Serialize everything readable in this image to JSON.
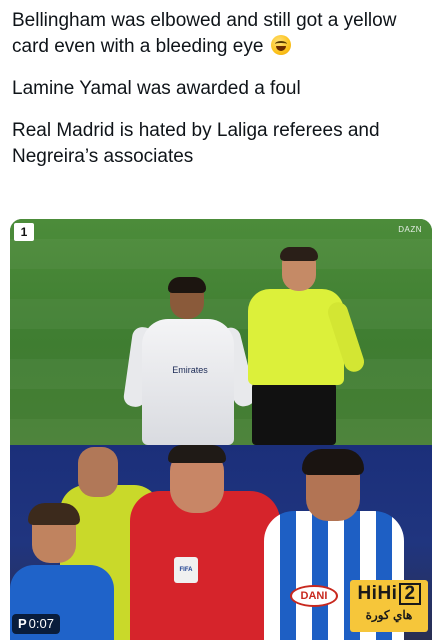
{
  "tweet": {
    "lines": [
      "Bellingham was elbowed and still got a yellow card even with a bleeding eye",
      "Lamine Yamal was awarded a foul",
      "Real Madrid is hated by Laliga referees and Negreira’s associates"
    ],
    "emoji_icon": "rofl-emoji-icon"
  },
  "media": {
    "video_timer": "0:07",
    "timer_prefix": "P",
    "top_scene": {
      "badge_text": "1",
      "corner_logo": "DAZN",
      "jersey_text": "Emirates"
    },
    "bottom_scene": {
      "fifa_badge": "FIFA",
      "sponsor_text": "DANI"
    },
    "watermark": {
      "brand": "HiHi",
      "brand_number": "2",
      "arabic": "هاي كورة"
    }
  }
}
